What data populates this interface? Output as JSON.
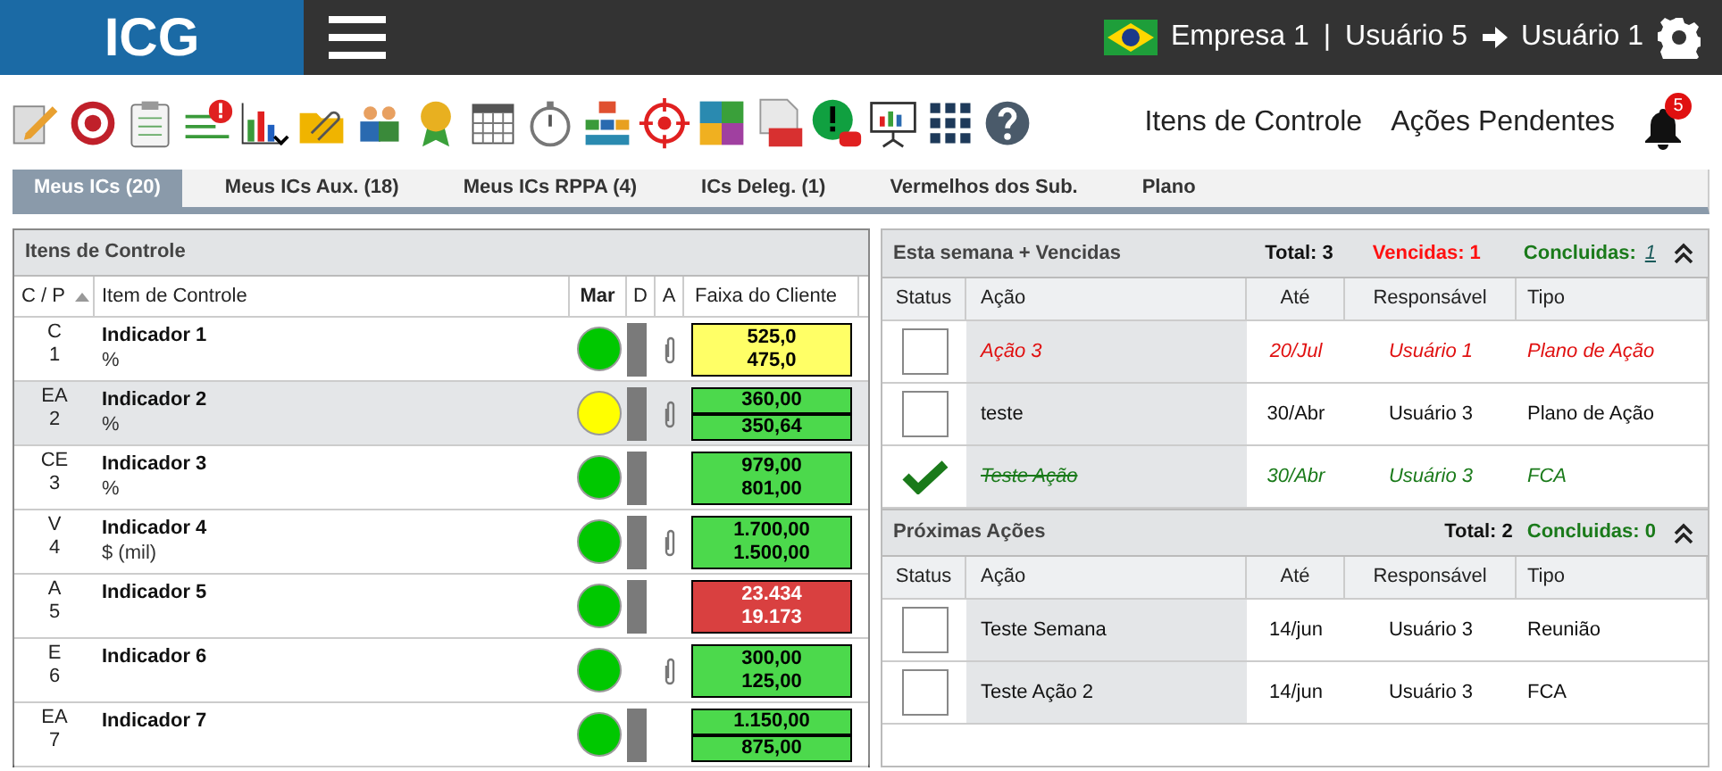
{
  "header": {
    "logo": "ICG",
    "company": "Empresa 1",
    "separator": "|",
    "user_from": "Usuário 5",
    "user_to": "Usuário 1"
  },
  "toolbar": {
    "links": [
      "Itens de Controle",
      "Ações Pendentes"
    ],
    "notifications": "5"
  },
  "tabs": [
    {
      "label": "Meus ICs (20)",
      "selected": true
    },
    {
      "label": "Meus ICs Aux. (18)",
      "selected": false
    },
    {
      "label": "Meus ICs RPPA (4)",
      "selected": false
    },
    {
      "label": "ICs Deleg. (1)",
      "selected": false
    },
    {
      "label": "Vermelhos dos Sub.",
      "selected": false
    },
    {
      "label": "Plano",
      "selected": false
    }
  ],
  "items_panel": {
    "title": "Itens de Controle",
    "columns": [
      "C / P",
      "Item de Controle",
      "Mar",
      "D",
      "A",
      "Faixa do Cliente"
    ],
    "rows": [
      {
        "code": "C",
        "number": "1",
        "name": "Indicador 1",
        "unit": "%",
        "selected": false,
        "color": "#00c800",
        "d_bar": true,
        "attachment": true,
        "range": [
          "525,0",
          "475,0"
        ],
        "range_warning": true,
        "range_alarm": false,
        "split": false
      },
      {
        "code": "EA",
        "number": "2",
        "name": "Indicador 2",
        "unit": "%",
        "selected": true,
        "color": "#ffff00",
        "d_bar": true,
        "attachment": true,
        "range": [
          "360,00",
          "350,64"
        ],
        "range_warning": false,
        "range_alarm": false,
        "split": true
      },
      {
        "code": "CE",
        "number": "3",
        "name": "Indicador 3",
        "unit": "%",
        "selected": false,
        "color": "#00c800",
        "d_bar": true,
        "attachment": false,
        "range": [
          "979,00",
          "801,00"
        ],
        "range_warning": false,
        "range_alarm": false,
        "split": false
      },
      {
        "code": "V",
        "number": "4",
        "name": "Indicador 4",
        "unit": "$ (mil)",
        "selected": false,
        "color": "#00c800",
        "d_bar": true,
        "attachment": true,
        "range": [
          "1.700,00",
          "1.500,00"
        ],
        "range_warning": false,
        "range_alarm": false,
        "split": false
      },
      {
        "code": "A",
        "number": "5",
        "name": "Indicador 5",
        "selected": false,
        "color": "#00c800",
        "d_bar": true,
        "attachment": false,
        "range": [
          "23.434",
          "19.173"
        ],
        "range_warning": false,
        "range_alarm": true,
        "split": false
      },
      {
        "code": "E",
        "number": "6",
        "name": "Indicador 6",
        "selected": false,
        "color": "#00c800",
        "d_bar": false,
        "attachment": true,
        "range": [
          "300,00",
          "125,00"
        ],
        "range_warning": false,
        "range_alarm": false,
        "split": false
      },
      {
        "code": "EA",
        "number": "7",
        "name": "Indicador 7",
        "selected": false,
        "color": "#00c800",
        "d_bar": true,
        "attachment": false,
        "range": [
          "1.150,00",
          "875,00"
        ],
        "range_warning": false,
        "range_alarm": false,
        "split": true
      }
    ]
  },
  "action_sections": [
    {
      "title": "Esta semana + Vencidas",
      "total": "Total: 3",
      "overdue": "Vencidas: 1",
      "done_label": "Concluidas:",
      "done_count": "1",
      "columns": [
        "Status",
        "Ação",
        "Até",
        "Responsável",
        "Tipo"
      ],
      "rows": [
        {
          "overdue": true,
          "done": false,
          "action": "Ação 3",
          "due": "20/Jul",
          "owner": "Usuário 1",
          "type": "Plano de Ação"
        },
        {
          "overdue": false,
          "done": false,
          "action": "teste",
          "due": "30/Abr",
          "owner": "Usuário 3",
          "type": "Plano de Ação"
        },
        {
          "overdue": false,
          "done": true,
          "action": "Teste Ação",
          "due": "30/Abr",
          "owner": "Usuário 3",
          "type": "FCA"
        }
      ]
    },
    {
      "title": "Próximas Ações",
      "total": "Total: 2",
      "done_label": "Concluidas: 0",
      "columns": [
        "Status",
        "Ação",
        "Até",
        "Responsável",
        "Tipo"
      ],
      "rows": [
        {
          "overdue": false,
          "done": false,
          "action": "Teste Semana",
          "due": "14/jun",
          "owner": "Usuário 3",
          "type": "Reunião"
        },
        {
          "overdue": false,
          "done": false,
          "action": "Teste Ação 2",
          "due": "14/jun",
          "owner": "Usuário 3",
          "type": "FCA"
        }
      ]
    }
  ]
}
